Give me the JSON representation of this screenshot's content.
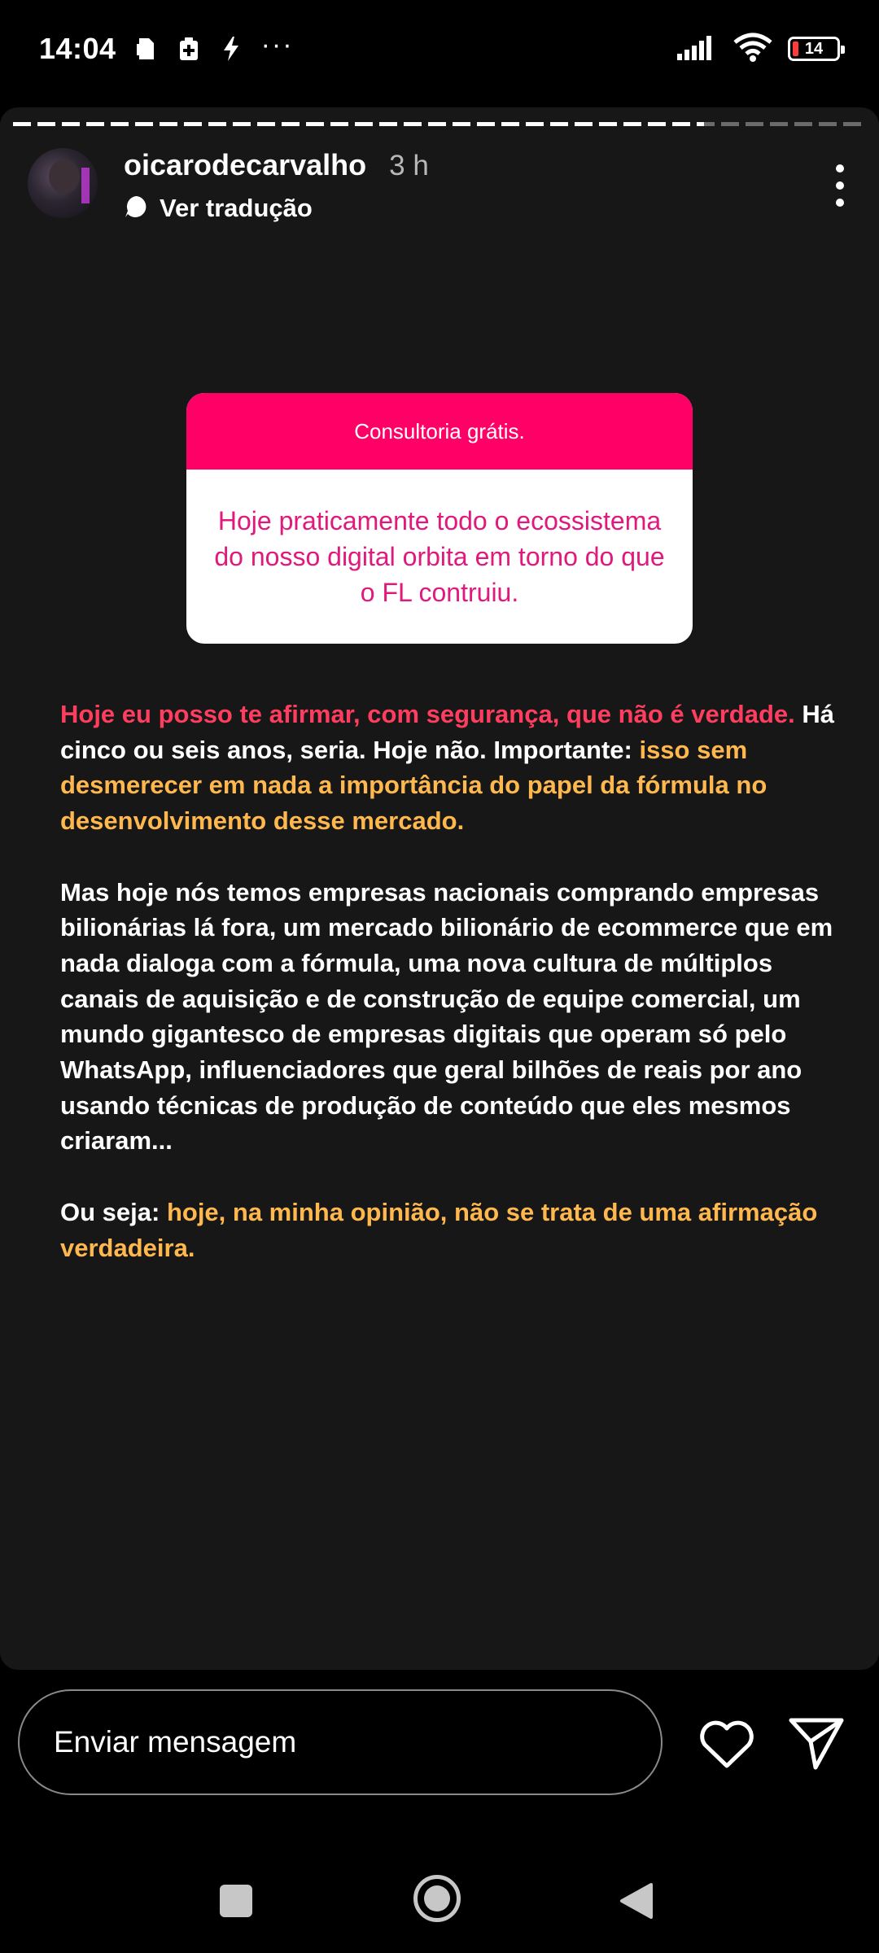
{
  "status_bar": {
    "time": "14:04",
    "battery_level": "14",
    "dots": "···"
  },
  "story": {
    "progress_fraction": 0.81,
    "username": "oicarodecarvalho",
    "time_ago": "3 h",
    "translate_label": "Ver tradução",
    "sticker": {
      "title": "Consultoria grátis.",
      "answer": "Hoje praticamente todo o ecossistema do nosso digital orbita em torno do que o FL contruiu.",
      "header_color": "#ff0066",
      "answer_color": "#e0197d"
    },
    "text": {
      "p1_red": "Hoje eu posso te afirmar, com segurança, que não é verdade.",
      "p1_white": " Há cinco ou seis anos, seria. Hoje não. Importante:",
      "p1_yellow": " isso sem desmerecer em nada a importância do papel da fórmula no desenvolvimento desse mercado.",
      "p2": "Mas hoje nós temos empresas nacionais comprando empresas bilionárias lá fora, um mercado bilionário de ecommerce que em nada dialoga com a fórmula, uma nova cultura de múltiplos canais de aquisição e de construção de equipe comercial, um mundo gigantesco de empresas digitais que operam só pelo WhatsApp, influenciadores que geral bilhões de reais por ano usando técnicas de produção de conteúdo que eles mesmos criaram...",
      "p3_white": "Ou seja:",
      "p3_yellow": " hoje, na minha opinião, não se trata de uma afirmação verdadeira."
    },
    "colors": {
      "red": "#ff3d5f",
      "yellow": "#ffb84d",
      "background": "#171717"
    }
  },
  "reply_bar": {
    "placeholder": "Enviar mensagem",
    "like_icon": "heart-icon",
    "share_icon": "send-icon"
  },
  "nav_bar": {
    "recent_icon": "square-icon",
    "home_icon": "circle-icon",
    "back_icon": "triangle-back-icon"
  }
}
